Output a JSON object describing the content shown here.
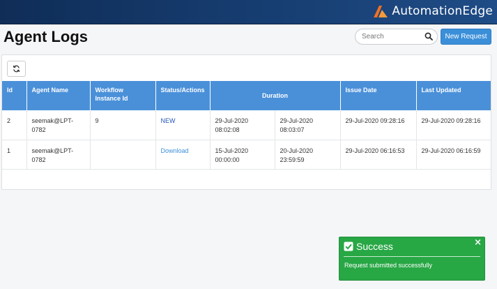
{
  "header": {
    "brand": "AutomationEdge",
    "logo_icon": "automationedge-logo-icon",
    "accent": "#f26f21"
  },
  "page": {
    "title": "Agent Logs"
  },
  "toolbar": {
    "search_placeholder": "Search",
    "search_value": "",
    "search_icon": "search-icon",
    "new_request_label": "New Request",
    "refresh_icon": "refresh-icon"
  },
  "table": {
    "headers": {
      "id": "Id",
      "agent_name": "Agent Name",
      "workflow_line1": "Workflow",
      "workflow_line2": "Instance Id",
      "status": "Status/Actions",
      "duration": "Duration",
      "issue_date": "Issue Date",
      "last_updated": "Last Updated"
    },
    "rows": [
      {
        "id": "2",
        "agent_line1": "seemak@LPT-",
        "agent_line2": "0782",
        "workflow_instance_id": "9",
        "status": "NEW",
        "duration_from_date": "29-Jul-2020",
        "duration_from_time": "08:02:08",
        "duration_to_date": "29-Jul-2020",
        "duration_to_time": "08:03:07",
        "issue_date": "29-Jul-2020 09:28:16",
        "last_updated": "29-Jul-2020 09:28:16"
      },
      {
        "id": "1",
        "agent_line1": "seemak@LPT-",
        "agent_line2": "0782",
        "workflow_instance_id": "",
        "status": "Download",
        "duration_from_date": "15-Jul-2020",
        "duration_from_time": "00:00:00",
        "duration_to_date": "20-Jul-2020",
        "duration_to_time": "23:59:59",
        "issue_date": "29-Jul-2020 06:16:53",
        "last_updated": "29-Jul-2020 06:16:59"
      }
    ]
  },
  "toast": {
    "title": "Success",
    "message": "Request submitted successfully",
    "close": "×",
    "check_icon": "check-square-icon",
    "color": "#28a745"
  }
}
